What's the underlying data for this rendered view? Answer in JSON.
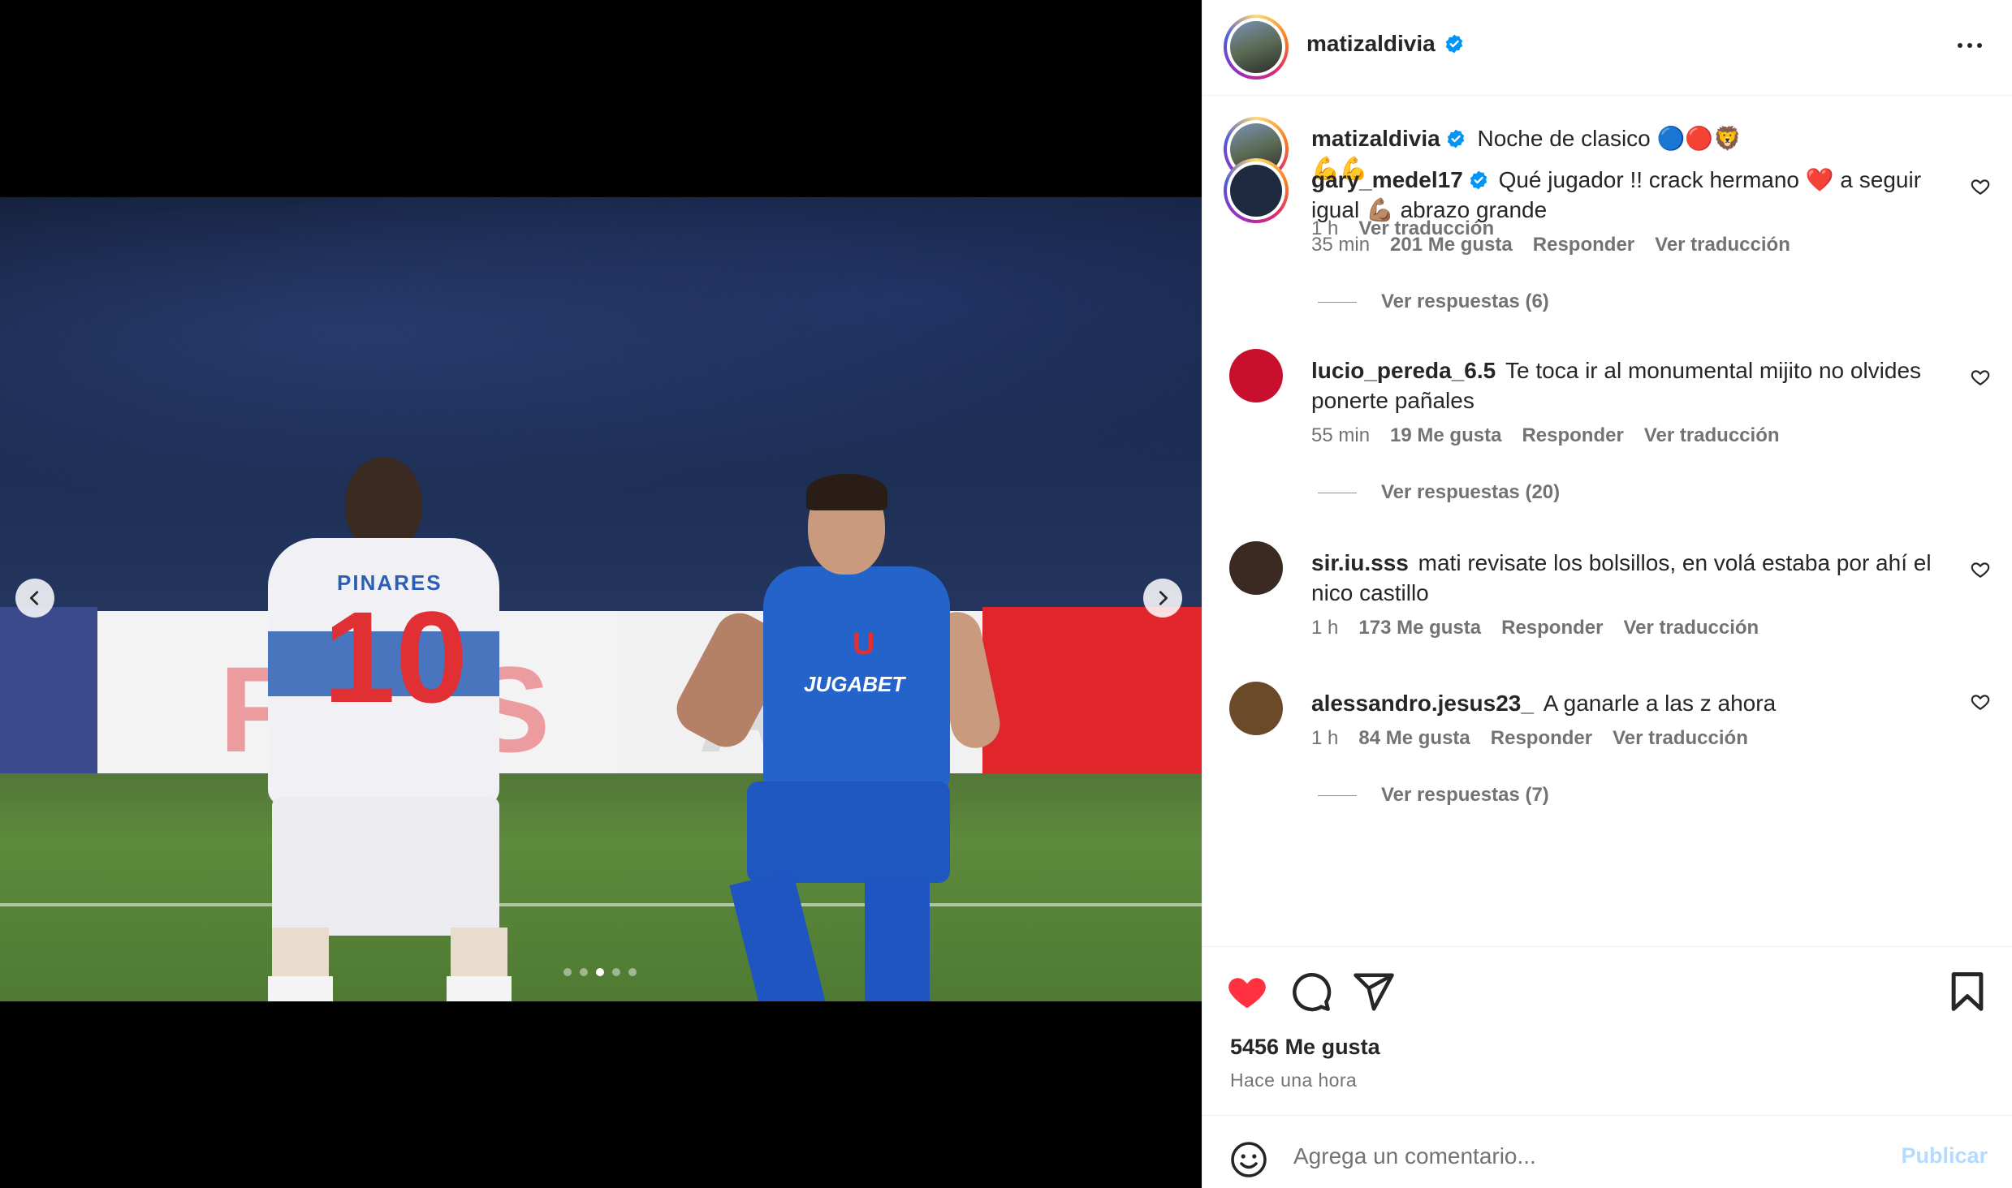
{
  "media": {
    "photo_alt": "",
    "shirt_name": "PINARES",
    "shirt_number": "10",
    "sponsor": "JUGABET",
    "crest": "U",
    "carousel": {
      "count": 5,
      "active_index": 2
    }
  },
  "header": {
    "username": "matizaldivia",
    "verified": true
  },
  "caption": {
    "username": "matizaldivia",
    "text": "Noche de clasico 🔵🔴🦁",
    "text_line2": "💪💪",
    "time": "1 h",
    "translate": "Ver traducción"
  },
  "comments": [
    {
      "username": "gary_medel17",
      "verified": true,
      "text": "Qué jugador !! crack hermano ❤️ a seguir igual 💪🏽 abrazo grande",
      "time": "35 min",
      "likes": "201 Me gusta",
      "reply": "Responder",
      "translate": "Ver traducción",
      "replies": "Ver respuestas (6)",
      "avatar_color": "#1d2a3f"
    },
    {
      "username": "lucio_pereda_6.5",
      "verified": false,
      "text": "Te toca ir al monumental mijito no olvides ponerte pañales",
      "time": "55 min",
      "likes": "19 Me gusta",
      "reply": "Responder",
      "translate": "Ver traducción",
      "replies": "Ver respuestas (20)",
      "avatar_color": "#c8102e"
    },
    {
      "username": "sir.iu.sss",
      "verified": false,
      "text": "mati revisate los bolsillos, en volá estaba por ahí el nico castillo",
      "time": "1 h",
      "likes": "173 Me gusta",
      "reply": "Responder",
      "translate": "Ver traducción",
      "replies": "",
      "avatar_color": "#3a2a22"
    },
    {
      "username": "alessandro.jesus23_",
      "verified": false,
      "text": "A ganarle a las z ahora",
      "time": "1 h",
      "likes": "84 Me gusta",
      "reply": "Responder",
      "translate": "Ver traducción",
      "replies": "Ver respuestas (7)",
      "avatar_color": "#6b4a2a"
    }
  ],
  "actions": {
    "like_icon": "heart-filled-icon",
    "comment_icon": "comment-icon",
    "share_icon": "share-icon",
    "save_icon": "bookmark-icon",
    "like_color": "#ff3040"
  },
  "stats": {
    "likes": "5456 Me gusta",
    "time": "Hace una hora"
  },
  "composer": {
    "placeholder": "Agrega un comentario...",
    "publish": "Publicar"
  }
}
